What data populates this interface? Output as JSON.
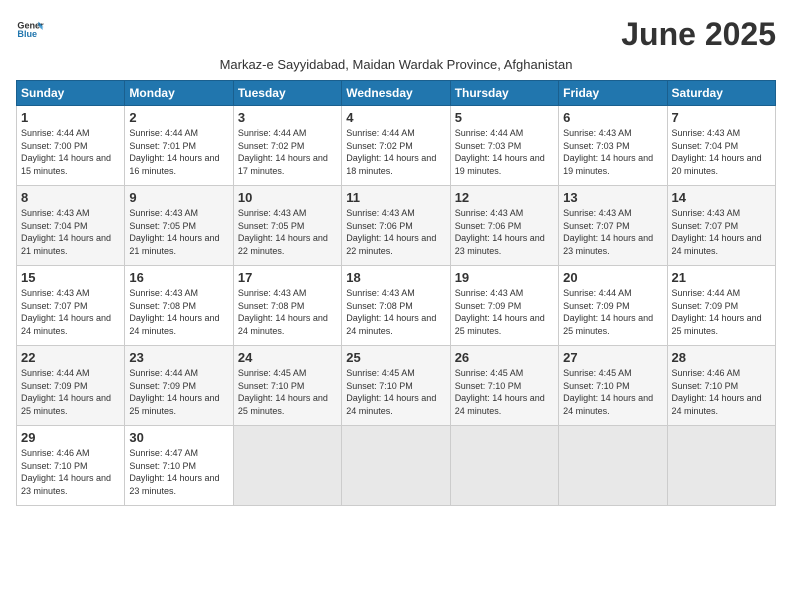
{
  "header": {
    "logo_line1": "General",
    "logo_line2": "Blue",
    "month_title": "June 2025",
    "subtitle": "Markaz-e Sayyidabad, Maidan Wardak Province, Afghanistan"
  },
  "days_of_week": [
    "Sunday",
    "Monday",
    "Tuesday",
    "Wednesday",
    "Thursday",
    "Friday",
    "Saturday"
  ],
  "weeks": [
    [
      {
        "day": "1",
        "sunrise": "Sunrise: 4:44 AM",
        "sunset": "Sunset: 7:00 PM",
        "daylight": "Daylight: 14 hours and 15 minutes."
      },
      {
        "day": "2",
        "sunrise": "Sunrise: 4:44 AM",
        "sunset": "Sunset: 7:01 PM",
        "daylight": "Daylight: 14 hours and 16 minutes."
      },
      {
        "day": "3",
        "sunrise": "Sunrise: 4:44 AM",
        "sunset": "Sunset: 7:02 PM",
        "daylight": "Daylight: 14 hours and 17 minutes."
      },
      {
        "day": "4",
        "sunrise": "Sunrise: 4:44 AM",
        "sunset": "Sunset: 7:02 PM",
        "daylight": "Daylight: 14 hours and 18 minutes."
      },
      {
        "day": "5",
        "sunrise": "Sunrise: 4:44 AM",
        "sunset": "Sunset: 7:03 PM",
        "daylight": "Daylight: 14 hours and 19 minutes."
      },
      {
        "day": "6",
        "sunrise": "Sunrise: 4:43 AM",
        "sunset": "Sunset: 7:03 PM",
        "daylight": "Daylight: 14 hours and 19 minutes."
      },
      {
        "day": "7",
        "sunrise": "Sunrise: 4:43 AM",
        "sunset": "Sunset: 7:04 PM",
        "daylight": "Daylight: 14 hours and 20 minutes."
      }
    ],
    [
      {
        "day": "8",
        "sunrise": "Sunrise: 4:43 AM",
        "sunset": "Sunset: 7:04 PM",
        "daylight": "Daylight: 14 hours and 21 minutes."
      },
      {
        "day": "9",
        "sunrise": "Sunrise: 4:43 AM",
        "sunset": "Sunset: 7:05 PM",
        "daylight": "Daylight: 14 hours and 21 minutes."
      },
      {
        "day": "10",
        "sunrise": "Sunrise: 4:43 AM",
        "sunset": "Sunset: 7:05 PM",
        "daylight": "Daylight: 14 hours and 22 minutes."
      },
      {
        "day": "11",
        "sunrise": "Sunrise: 4:43 AM",
        "sunset": "Sunset: 7:06 PM",
        "daylight": "Daylight: 14 hours and 22 minutes."
      },
      {
        "day": "12",
        "sunrise": "Sunrise: 4:43 AM",
        "sunset": "Sunset: 7:06 PM",
        "daylight": "Daylight: 14 hours and 23 minutes."
      },
      {
        "day": "13",
        "sunrise": "Sunrise: 4:43 AM",
        "sunset": "Sunset: 7:07 PM",
        "daylight": "Daylight: 14 hours and 23 minutes."
      },
      {
        "day": "14",
        "sunrise": "Sunrise: 4:43 AM",
        "sunset": "Sunset: 7:07 PM",
        "daylight": "Daylight: 14 hours and 24 minutes."
      }
    ],
    [
      {
        "day": "15",
        "sunrise": "Sunrise: 4:43 AM",
        "sunset": "Sunset: 7:07 PM",
        "daylight": "Daylight: 14 hours and 24 minutes."
      },
      {
        "day": "16",
        "sunrise": "Sunrise: 4:43 AM",
        "sunset": "Sunset: 7:08 PM",
        "daylight": "Daylight: 14 hours and 24 minutes."
      },
      {
        "day": "17",
        "sunrise": "Sunrise: 4:43 AM",
        "sunset": "Sunset: 7:08 PM",
        "daylight": "Daylight: 14 hours and 24 minutes."
      },
      {
        "day": "18",
        "sunrise": "Sunrise: 4:43 AM",
        "sunset": "Sunset: 7:08 PM",
        "daylight": "Daylight: 14 hours and 24 minutes."
      },
      {
        "day": "19",
        "sunrise": "Sunrise: 4:43 AM",
        "sunset": "Sunset: 7:09 PM",
        "daylight": "Daylight: 14 hours and 25 minutes."
      },
      {
        "day": "20",
        "sunrise": "Sunrise: 4:44 AM",
        "sunset": "Sunset: 7:09 PM",
        "daylight": "Daylight: 14 hours and 25 minutes."
      },
      {
        "day": "21",
        "sunrise": "Sunrise: 4:44 AM",
        "sunset": "Sunset: 7:09 PM",
        "daylight": "Daylight: 14 hours and 25 minutes."
      }
    ],
    [
      {
        "day": "22",
        "sunrise": "Sunrise: 4:44 AM",
        "sunset": "Sunset: 7:09 PM",
        "daylight": "Daylight: 14 hours and 25 minutes."
      },
      {
        "day": "23",
        "sunrise": "Sunrise: 4:44 AM",
        "sunset": "Sunset: 7:09 PM",
        "daylight": "Daylight: 14 hours and 25 minutes."
      },
      {
        "day": "24",
        "sunrise": "Sunrise: 4:45 AM",
        "sunset": "Sunset: 7:10 PM",
        "daylight": "Daylight: 14 hours and 25 minutes."
      },
      {
        "day": "25",
        "sunrise": "Sunrise: 4:45 AM",
        "sunset": "Sunset: 7:10 PM",
        "daylight": "Daylight: 14 hours and 24 minutes."
      },
      {
        "day": "26",
        "sunrise": "Sunrise: 4:45 AM",
        "sunset": "Sunset: 7:10 PM",
        "daylight": "Daylight: 14 hours and 24 minutes."
      },
      {
        "day": "27",
        "sunrise": "Sunrise: 4:45 AM",
        "sunset": "Sunset: 7:10 PM",
        "daylight": "Daylight: 14 hours and 24 minutes."
      },
      {
        "day": "28",
        "sunrise": "Sunrise: 4:46 AM",
        "sunset": "Sunset: 7:10 PM",
        "daylight": "Daylight: 14 hours and 24 minutes."
      }
    ],
    [
      {
        "day": "29",
        "sunrise": "Sunrise: 4:46 AM",
        "sunset": "Sunset: 7:10 PM",
        "daylight": "Daylight: 14 hours and 23 minutes."
      },
      {
        "day": "30",
        "sunrise": "Sunrise: 4:47 AM",
        "sunset": "Sunset: 7:10 PM",
        "daylight": "Daylight: 14 hours and 23 minutes."
      },
      null,
      null,
      null,
      null,
      null
    ]
  ]
}
